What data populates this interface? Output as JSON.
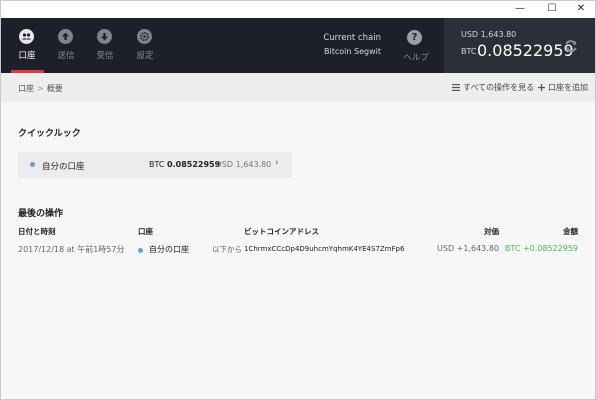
{
  "window": {
    "min_glyph": "—",
    "max_glyph": "☐",
    "close_glyph": "✕"
  },
  "nav": {
    "items": [
      {
        "label": "口座",
        "icon": "users-icon",
        "active": true
      },
      {
        "label": "送信",
        "icon": "arrow-up-icon",
        "active": false
      },
      {
        "label": "受信",
        "icon": "arrow-down-icon",
        "active": false
      },
      {
        "label": "設定",
        "icon": "gear-icon",
        "active": false
      }
    ]
  },
  "chain": {
    "label": "Current chain",
    "value": "Bitcoin Segwit"
  },
  "help": {
    "label": "ヘルプ",
    "glyph": "?"
  },
  "balance": {
    "usd": "USD 1,643.80",
    "btc_unit": "BTC",
    "btc_value": "0.08522959"
  },
  "breadcrumb": {
    "root": "口座",
    "separator": ">",
    "current": "概要"
  },
  "actions": {
    "all_ops": "すべての操作を見る",
    "add_account": "口座を追加"
  },
  "quick_look": {
    "title": "クイックルック",
    "account": {
      "name": "自分の口座",
      "btc_unit": "BTC",
      "btc_value": "0.08522959",
      "usd": "USD 1,643.80",
      "arrow": "›"
    }
  },
  "recent_ops": {
    "title": "最後の操作",
    "headers": {
      "date": "日付と時刻",
      "account": "口座",
      "address": "ビットコインアドレス",
      "counter": "対価",
      "amount": "金額"
    },
    "rows": [
      {
        "date": "2017/12/18 at 午前1時57分",
        "account": "自分の口座",
        "direction": "以下から",
        "address": "1ChrmxCCcDp4D9uhcmYqhmK4YE4S7ZmFp6",
        "counter": "USD +1,643.80",
        "amount": "BTC +0.08522959"
      }
    ]
  },
  "colors": {
    "accent_red": "#e0383e",
    "dot_blue": "#5fa1d2",
    "positive_green": "#4ab454",
    "topbar": "#1d2028"
  }
}
